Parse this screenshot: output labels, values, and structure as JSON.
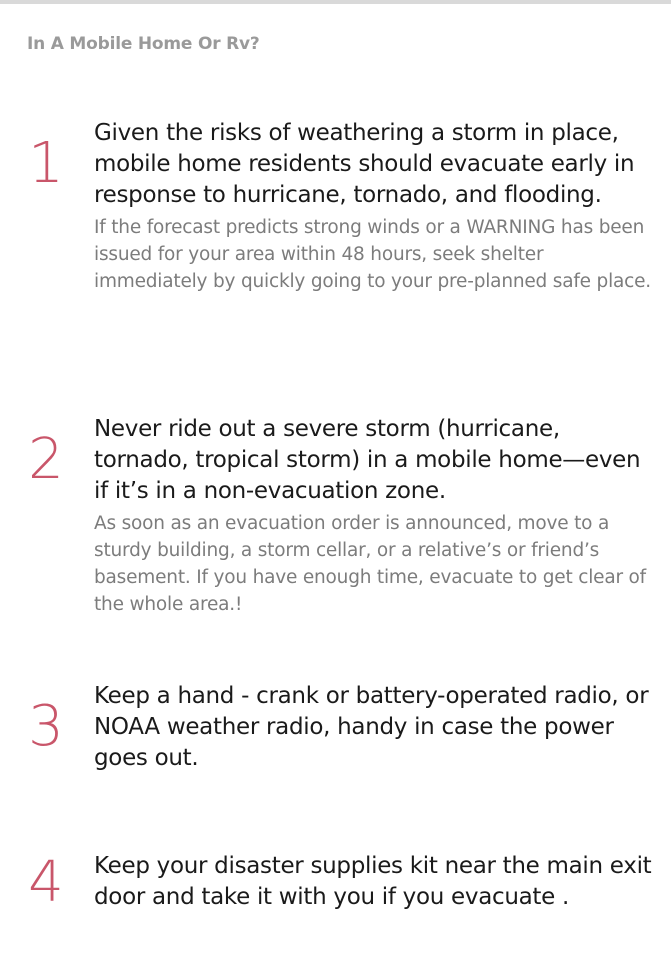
{
  "page": {
    "title": "In A Mobile Home Or Rv?"
  },
  "steps": [
    {
      "number": "1",
      "heading": "Given the risks of weathering a storm in place, mobile home residents should evacuate early in response to hurricane, tornado, and flooding.",
      "detail": "If the forecast predicts strong winds or a WARNING has been issued for your area within 48 hours, seek shelter immediately by quickly going to your pre-planned safe place."
    },
    {
      "number": "2",
      "heading": "Never  ride out a severe storm (hurricane, tornado, tropical storm) in a mobile home—even if it’s in a non-evacuation zone.",
      "detail": "As soon as an evacuation order is announced, move to a sturdy building, a storm cellar, or a relative’s or friend’s basement. If you have enough time, evacuate to get clear of the whole area.!"
    },
    {
      "number": "3",
      "heading": "Keep a hand - crank or battery-operated radio, or NOAA weather radio, handy in case the power goes out."
    },
    {
      "number": "4",
      "heading": "Keep your disaster supplies kit near the main exit door and take it with you if you evacuate ."
    }
  ],
  "colors": {
    "number": "#c9566a",
    "heading": "#1a1a1a",
    "detail": "#7c7c7c",
    "title": "#9a9a9a"
  }
}
